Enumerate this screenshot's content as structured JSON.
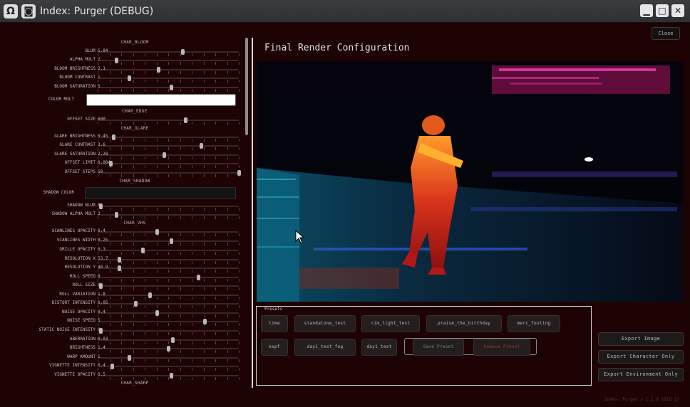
{
  "window": {
    "title": "Index: Purger (DEBUG)"
  },
  "header": {
    "title": "Final Render Configuration",
    "close_label": "Close"
  },
  "panel": {
    "sections": {
      "char_bloom": "CHAR_BLOOM",
      "char_edge": "CHAR_EDGE",
      "char_glare": "CHAR_GLARE",
      "char_shadow": "CHAR_SHADOW",
      "char_vhs": "CHAR_VHS",
      "char_sharp": "CHAR_SHARP"
    },
    "color_mult_label": "COLOR MULT",
    "color_mult_value": "#ffffff",
    "shadow_color_label": "SHADOW COLOR",
    "shadow_color_value": "#141414",
    "sliders": [
      {
        "label": "BLUR",
        "value": "5.84",
        "fraction": 0.6
      },
      {
        "label": "ALPHA MULT",
        "value": "2",
        "fraction": 0.13
      },
      {
        "label": "BLOOM BRIGHTNESS",
        "value": "2.1",
        "fraction": 0.43
      },
      {
        "label": "BLOOM CONTRAST",
        "value": "1",
        "fraction": 0.22
      },
      {
        "label": "BLOOM SATURATION",
        "value": "5",
        "fraction": 0.52
      },
      {
        "label": "OFFSET SIZE",
        "value": "600",
        "fraction": 0.62
      },
      {
        "label": "GLARE BRIGHTNESS",
        "value": "0.45",
        "fraction": 0.11
      },
      {
        "label": "GLARE CONTRAST",
        "value": "3.6",
        "fraction": 0.73
      },
      {
        "label": "GLARE SATURATION",
        "value": "2.28",
        "fraction": 0.47
      },
      {
        "label": "OFFSET LIMIT",
        "value": "0.004",
        "fraction": 0.09
      },
      {
        "label": "OFFSET STEPS",
        "value": "50",
        "fraction": 1.0
      },
      {
        "label": "SHADOW BLUR",
        "value": "0",
        "fraction": 0.02
      },
      {
        "label": "SHADOW ALPHA MULT",
        "value": "2",
        "fraction": 0.13
      },
      {
        "label": "SCANLINES OPACITY",
        "value": "0.4",
        "fraction": 0.42
      },
      {
        "label": "SCANLINES WIDTH",
        "value": "0.25",
        "fraction": 0.52
      },
      {
        "label": "GRILLE OPACITY",
        "value": "0.3",
        "fraction": 0.32
      },
      {
        "label": "RESOLUTION X",
        "value": "53.7",
        "fraction": 0.15
      },
      {
        "label": "RESOLUTION Y",
        "value": "48.9",
        "fraction": 0.15
      },
      {
        "label": "ROLL SPEED",
        "value": "8",
        "fraction": 0.71
      },
      {
        "label": "ROLL SIZE",
        "value": "0",
        "fraction": 0.02
      },
      {
        "label": "ROLL VARIATION",
        "value": "1.8",
        "fraction": 0.37
      },
      {
        "label": "DISTORT INTENSITY",
        "value": "0.05",
        "fraction": 0.27
      },
      {
        "label": "NOISE OPACITY",
        "value": "0.4",
        "fraction": 0.42
      },
      {
        "label": "NOISE SPEED",
        "value": "5",
        "fraction": 0.76
      },
      {
        "label": "STATIC NOISE INTENSITY",
        "value": "0",
        "fraction": 0.02
      },
      {
        "label": "ABERRATION",
        "value": "0.03",
        "fraction": 0.53
      },
      {
        "label": "BRIGHTNESS",
        "value": "1.4",
        "fraction": 0.5
      },
      {
        "label": "WARP AMOUNT",
        "value": "1",
        "fraction": 0.22
      },
      {
        "label": "VIGNETTE INTENSITY",
        "value": "0.4",
        "fraction": 0.1
      },
      {
        "label": "VIGNETTE OPACITY",
        "value": "0.5",
        "fraction": 0.52
      }
    ]
  },
  "presets": {
    "label": "Presets",
    "items": [
      "time",
      "standalone_test",
      "rim_light_test",
      "praise_the_birthday",
      "merc_fooling",
      "expf",
      "day1_test_fog",
      "day1_test"
    ],
    "save_label": "Save Preset",
    "remove_label": "Remove Preset"
  },
  "export": {
    "image": "Export Image",
    "character_only": "Export Character Only",
    "environment_only": "Export Environment Only"
  },
  "version": "Index: Purger v 1.2.0 (BID_1)",
  "colors": {
    "background": "#1d0303",
    "divider": "#d8d8d8",
    "save": "#5a8f87",
    "remove": "#9a3d2a"
  }
}
